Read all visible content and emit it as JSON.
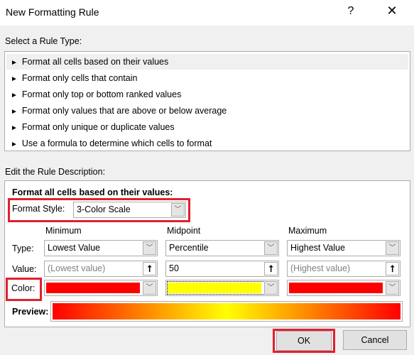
{
  "dialog": {
    "title": "New Formatting Rule",
    "help_icon": "?",
    "close_icon": "✕"
  },
  "rule_type": {
    "label": "Select a Rule Type:",
    "items": [
      "Format all cells based on their values",
      "Format only cells that contain",
      "Format only top or bottom ranked values",
      "Format only values that are above or below average",
      "Format only unique or duplicate values",
      "Use a formula to determine which cells to format"
    ],
    "selected_index": 0,
    "bullet": "►"
  },
  "description": {
    "label": "Edit the Rule Description:",
    "heading": "Format all cells based on their values:",
    "format_style_label": "Format Style:",
    "format_style_value": "3-Color Scale",
    "columns": [
      "Minimum",
      "Midpoint",
      "Maximum"
    ],
    "type_label": "Type:",
    "value_label": "Value:",
    "color_label": "Color:",
    "preview_label": "Preview:",
    "types": [
      "Lowest Value",
      "Percentile",
      "Highest Value"
    ],
    "values": [
      {
        "value": "",
        "placeholder": "(Lowest value)"
      },
      {
        "value": "50",
        "placeholder": ""
      },
      {
        "value": "",
        "placeholder": "(Highest value)"
      }
    ],
    "colors": [
      "#ff0000",
      "#ffff00",
      "#ff0000"
    ]
  },
  "buttons": {
    "ok": "OK",
    "cancel": "Cancel"
  },
  "highlight_color": "#e0202e"
}
